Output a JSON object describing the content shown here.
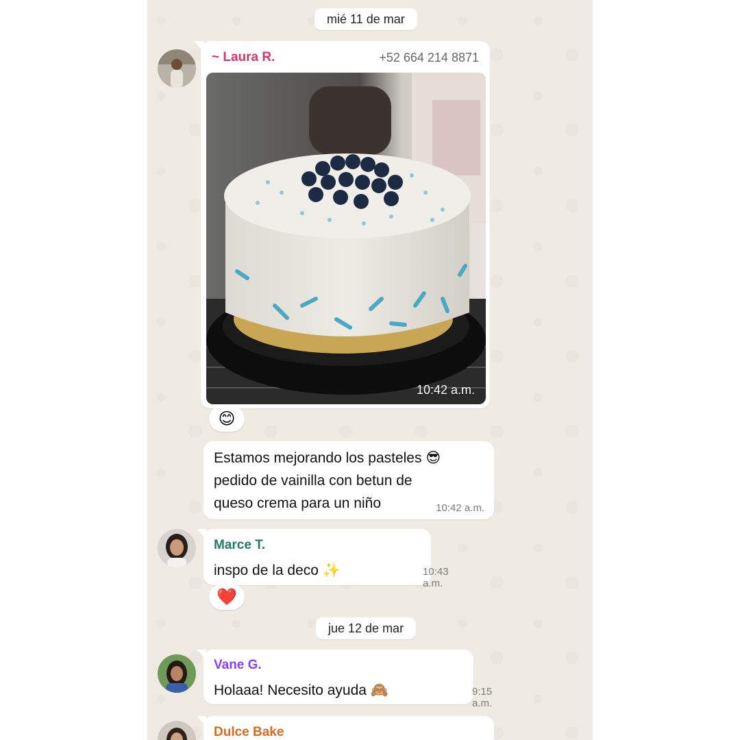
{
  "dates": {
    "first": "mié 11 de mar",
    "second": "jue 12 de mar"
  },
  "messages": {
    "laura": {
      "sender": "~ Laura R.",
      "phone": "+52 664 214 8871",
      "photo_time": "10:42 a.m.",
      "reaction": "😊",
      "text_lines": [
        "Estamos mejorando los pasteles",
        "pedido de vainilla con betun de",
        "queso crema para un niño"
      ],
      "text_emoji": "😎",
      "text_time": "10:42 a.m."
    },
    "marce": {
      "sender": "Marce T.",
      "text": "inspo de la deco",
      "emoji": "✨",
      "time": "10:43 a.m.",
      "reaction": "❤️"
    },
    "vane": {
      "sender": "Vane G.",
      "text": "Holaaa! Necesito ayuda",
      "emoji": "🙈",
      "time": "9:15 a.m."
    },
    "dulce": {
      "sender": "Dulce Bake"
    }
  },
  "colors": {
    "laura_name": "#d6336c",
    "marce_name": "#1f7a66",
    "vane_name": "#8a3ffc",
    "dulce_name": "#d96a1d",
    "chat_bg": "#efeae2"
  }
}
